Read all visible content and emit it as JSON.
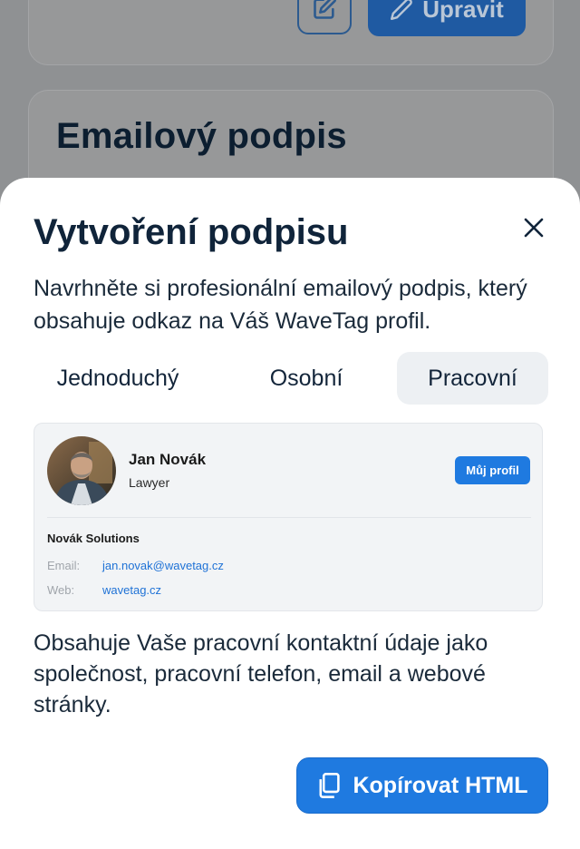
{
  "background": {
    "edit_button_label": "Upravit",
    "section_heading": "Emailový podpis"
  },
  "sheet": {
    "title": "Vytvoření podpisu",
    "description": "Navrhněte si profesionální emailový podpis, který obsahuje odkaz na Váš WaveTag profil.",
    "tabs": [
      {
        "label": "Jednoduchý",
        "active": false
      },
      {
        "label": "Osobní",
        "active": false
      },
      {
        "label": "Pracovní",
        "active": true
      }
    ],
    "preview": {
      "name": "Jan Novák",
      "role": "Lawyer",
      "profile_button": "Můj profil",
      "company": "Novák Solutions",
      "email_label": "Email:",
      "email_value": "jan.novak@wavetag.cz",
      "web_label": "Web:",
      "web_value": "wavetag.cz"
    },
    "info_text": "Obsahuje Vaše pracovní kontaktní údaje jako společnost, pracovní telefon, email a webové stránky.",
    "copy_button": "Kopírovat HTML"
  },
  "colors": {
    "accent": "#1f7ae0",
    "overlay": "#8f9193",
    "text_primary": "#10243a",
    "link": "#1f72d6"
  },
  "icons": {
    "close": "close-icon",
    "copy": "copy-icon",
    "edit": "pencil-icon",
    "edit_square": "edit-square-icon"
  }
}
